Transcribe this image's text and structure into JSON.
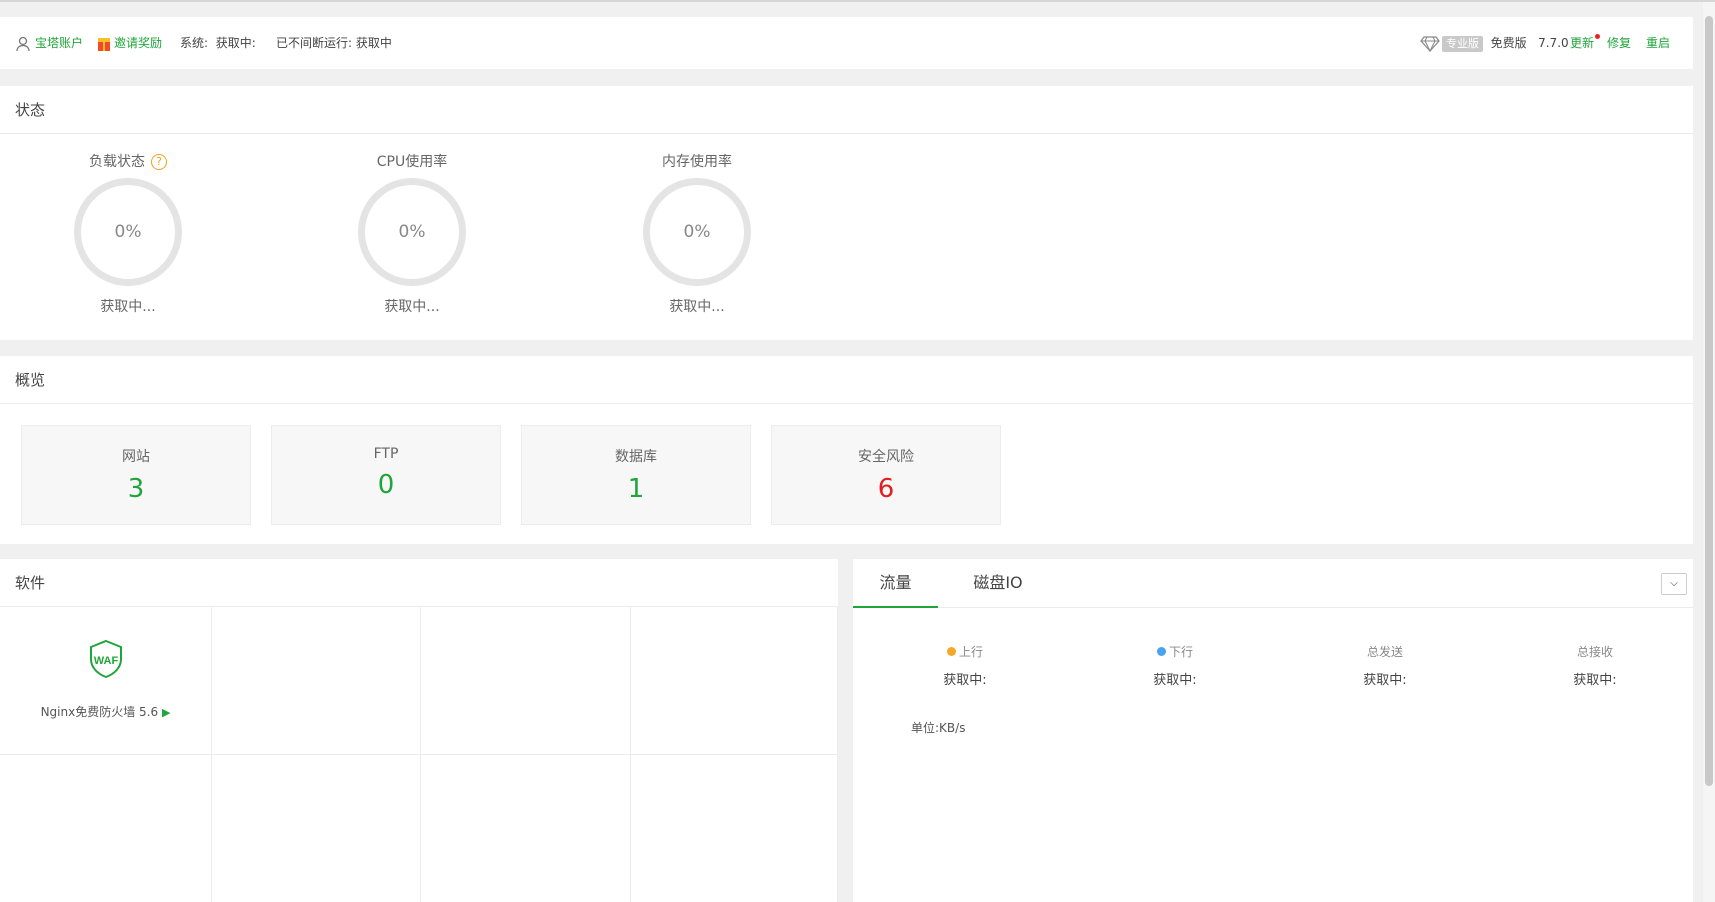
{
  "topbar": {
    "account": "宝塔账户",
    "invite": "邀请奖励",
    "system_label": "系统:",
    "system_value": "获取中:",
    "uptime": "已不间断运行: 获取中",
    "pro_badge": "专业版",
    "edition": "免费版",
    "version": "7.7.0",
    "update": "更新",
    "repair": "修复",
    "restart": "重启"
  },
  "status": {
    "title": "状态",
    "gauges": [
      {
        "title": "负载状态",
        "value": "0%",
        "sub": "获取中..."
      },
      {
        "title": "CPU使用率",
        "value": "0%",
        "sub": "获取中..."
      },
      {
        "title": "内存使用率",
        "value": "0%",
        "sub": "获取中..."
      }
    ]
  },
  "overview": {
    "title": "概览",
    "items": [
      {
        "label": "网站",
        "value": "3",
        "color": "#20a53a"
      },
      {
        "label": "FTP",
        "value": "0",
        "color": "#20a53a"
      },
      {
        "label": "数据库",
        "value": "1",
        "color": "#20a53a"
      },
      {
        "label": "安全风险",
        "value": "6",
        "color": "#e02020"
      }
    ]
  },
  "software": {
    "title": "软件",
    "items": [
      {
        "icon": "waf-shield-icon",
        "logo_text": "WAF",
        "name": "Nginx免费防火墙 5.6",
        "arrow": "▶"
      }
    ]
  },
  "traffic": {
    "tabs": [
      "流量",
      "磁盘IO"
    ],
    "active_tab": "流量",
    "stats": [
      {
        "label": "上行",
        "value": "获取中:",
        "dot_color": "#f6a72a"
      },
      {
        "label": "下行",
        "value": "获取中:",
        "dot_color": "#48a4ef"
      },
      {
        "label": "总发送",
        "value": "获取中:"
      },
      {
        "label": "总接收",
        "value": "获取中:"
      }
    ],
    "unit": "单位:KB/s"
  },
  "colors": {
    "accent": "#20a53a",
    "danger": "#e02020"
  }
}
